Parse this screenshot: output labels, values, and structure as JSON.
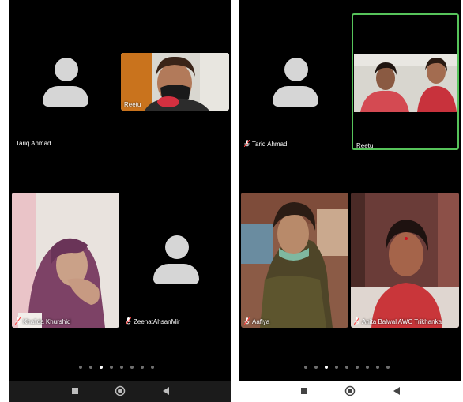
{
  "left_screen": {
    "participants": [
      {
        "name": "Tariq Ahmad",
        "video": false
      },
      {
        "name": "Reetu",
        "video": true
      },
      {
        "name": "Khalida Khurshid",
        "video": true
      },
      {
        "name": "ZeenatAhsanMir",
        "video": false
      }
    ],
    "page_indicator": {
      "count": 8,
      "active_index": 2
    }
  },
  "right_screen": {
    "participants": [
      {
        "name": "Tariq Ahmad",
        "video": false
      },
      {
        "name": "Reetu",
        "video": true,
        "active_speaker": true
      },
      {
        "name": "Aafiya",
        "video": true
      },
      {
        "name": "Anita Balwal AWC Trikhanka",
        "video": true
      }
    ],
    "page_indicator": {
      "count": 9,
      "active_index": 2
    }
  },
  "nav_bar": {
    "buttons": [
      "recents-square",
      "home-circle",
      "back-triangle"
    ]
  },
  "colors": {
    "background": "#000000",
    "avatar": "#d6d6d6",
    "active_border": "#56c35a",
    "nav_bar": "#1b1b1b"
  }
}
